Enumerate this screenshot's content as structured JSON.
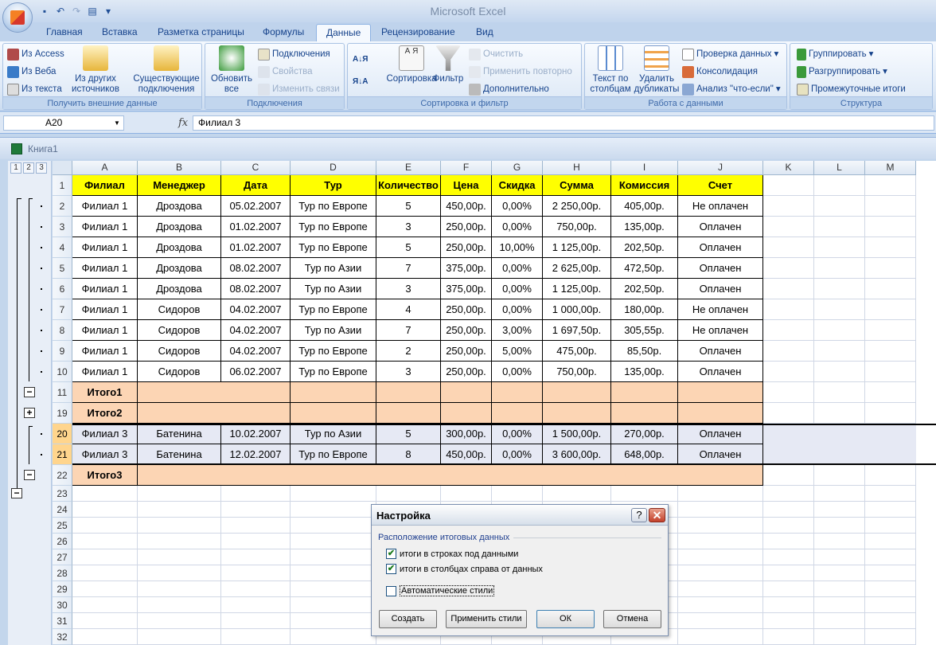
{
  "app": {
    "title": "Microsoft Excel",
    "workbook": "Книга1"
  },
  "tabs": [
    "Главная",
    "Вставка",
    "Разметка страницы",
    "Формулы",
    "Данные",
    "Рецензирование",
    "Вид"
  ],
  "active_tab": "Данные",
  "ribbon": {
    "external": {
      "caption": "Получить внешние данные",
      "from_access": "Из Access",
      "from_web": "Из Веба",
      "from_text": "Из текста",
      "from_other_1": "Из других",
      "from_other_2": "источников",
      "existing_1": "Существующие",
      "existing_2": "подключения"
    },
    "connections": {
      "caption": "Подключения",
      "refresh_1": "Обновить",
      "refresh_2": "все",
      "connections": "Подключения",
      "properties": "Свойства",
      "edit_links": "Изменить связи"
    },
    "sort": {
      "caption": "Сортировка и фильтр",
      "az": "А Я",
      "sort": "Сортировка",
      "filter": "Фильтр",
      "clear": "Очистить",
      "reapply": "Применить повторно",
      "advanced": "Дополнительно"
    },
    "datatools": {
      "caption": "Работа с данными",
      "text_cols_1": "Текст по",
      "text_cols_2": "столбцам",
      "remove_dup_1": "Удалить",
      "remove_dup_2": "дубликаты",
      "validation": "Проверка данных",
      "consolidate": "Консолидация",
      "whatif": "Анализ \"что-если\""
    },
    "outline": {
      "caption": "Структура",
      "group": "Группировать",
      "ungroup": "Разгруппировать",
      "subtotal": "Промежуточные итоги"
    }
  },
  "formula_bar": {
    "name_box": "A20",
    "fx": "fx",
    "value": "Филиал 3"
  },
  "outline_levels": [
    "1",
    "2",
    "3"
  ],
  "columns": [
    "A",
    "B",
    "C",
    "D",
    "E",
    "F",
    "G",
    "H",
    "I",
    "J",
    "K",
    "L",
    "M"
  ],
  "header_row": [
    "Филиал",
    "Менеджер",
    "Дата",
    "Тур",
    "Количество",
    "Цена",
    "Скидка",
    "Сумма",
    "Комиссия",
    "Счет"
  ],
  "rows": [
    {
      "n": "1",
      "type": "hdr"
    },
    {
      "n": "2",
      "type": "data",
      "cells": [
        "Филиал 1",
        "Дроздова",
        "05.02.2007",
        "Тур по Европе",
        "5",
        "450,00р.",
        "0,00%",
        "2 250,00р.",
        "405,00р.",
        "Не оплачен"
      ]
    },
    {
      "n": "3",
      "type": "data",
      "cells": [
        "Филиал 1",
        "Дроздова",
        "01.02.2007",
        "Тур по Европе",
        "3",
        "250,00р.",
        "0,00%",
        "750,00р.",
        "135,00р.",
        "Оплачен"
      ]
    },
    {
      "n": "4",
      "type": "data",
      "cells": [
        "Филиал 1",
        "Дроздова",
        "01.02.2007",
        "Тур по Европе",
        "5",
        "250,00р.",
        "10,00%",
        "1 125,00р.",
        "202,50р.",
        "Оплачен"
      ]
    },
    {
      "n": "5",
      "type": "data",
      "cells": [
        "Филиал 1",
        "Дроздова",
        "08.02.2007",
        "Тур по Азии",
        "7",
        "375,00р.",
        "0,00%",
        "2 625,00р.",
        "472,50р.",
        "Оплачен"
      ]
    },
    {
      "n": "6",
      "type": "data",
      "cells": [
        "Филиал 1",
        "Дроздова",
        "08.02.2007",
        "Тур по Азии",
        "3",
        "375,00р.",
        "0,00%",
        "1 125,00р.",
        "202,50р.",
        "Оплачен"
      ]
    },
    {
      "n": "7",
      "type": "data",
      "cells": [
        "Филиал 1",
        "Сидоров",
        "04.02.2007",
        "Тур по Европе",
        "4",
        "250,00р.",
        "0,00%",
        "1 000,00р.",
        "180,00р.",
        "Не оплачен"
      ]
    },
    {
      "n": "8",
      "type": "data",
      "cells": [
        "Филиал 1",
        "Сидоров",
        "04.02.2007",
        "Тур по Азии",
        "7",
        "250,00р.",
        "3,00%",
        "1 697,50р.",
        "305,55р.",
        "Не оплачен"
      ]
    },
    {
      "n": "9",
      "type": "data",
      "cells": [
        "Филиал 1",
        "Сидоров",
        "04.02.2007",
        "Тур по Европе",
        "2",
        "250,00р.",
        "5,00%",
        "475,00р.",
        "85,50р.",
        "Оплачен"
      ]
    },
    {
      "n": "10",
      "type": "data",
      "cells": [
        "Филиал 1",
        "Сидоров",
        "06.02.2007",
        "Тур по Европе",
        "3",
        "250,00р.",
        "0,00%",
        "750,00р.",
        "135,00р.",
        "Оплачен"
      ]
    },
    {
      "n": "11",
      "type": "total",
      "cells": [
        "Итого1"
      ]
    },
    {
      "n": "19",
      "type": "total",
      "cells": [
        "Итого2"
      ]
    },
    {
      "n": "20",
      "type": "sel",
      "cells": [
        "Филиал 3",
        "Батенина",
        "10.02.2007",
        "Тур по Азии",
        "5",
        "300,00р.",
        "0,00%",
        "1 500,00р.",
        "270,00р.",
        "Оплачен"
      ]
    },
    {
      "n": "21",
      "type": "sel",
      "cells": [
        "Филиал 3",
        "Батенина",
        "12.02.2007",
        "Тур по Европе",
        "8",
        "450,00р.",
        "0,00%",
        "3 600,00р.",
        "648,00р.",
        "Оплачен"
      ]
    },
    {
      "n": "22",
      "type": "total",
      "cells": [
        "Итого3"
      ]
    },
    {
      "n": "23",
      "type": "empty"
    },
    {
      "n": "24",
      "type": "empty"
    },
    {
      "n": "25",
      "type": "empty"
    },
    {
      "n": "26",
      "type": "empty"
    },
    {
      "n": "27",
      "type": "empty"
    },
    {
      "n": "28",
      "type": "empty"
    },
    {
      "n": "29",
      "type": "empty"
    },
    {
      "n": "30",
      "type": "empty"
    },
    {
      "n": "31",
      "type": "empty"
    },
    {
      "n": "32",
      "type": "empty"
    }
  ],
  "outline_buttons": {
    "minus": "−",
    "plus": "+"
  },
  "dialog": {
    "title": "Настройка",
    "help": "?",
    "close": "✕",
    "section": "Расположение итоговых данных",
    "check1": "итоги в строках под данными",
    "check2": "итоги в столбцах справа от данных",
    "check3": "Автоматические стили",
    "check1_state": true,
    "check2_state": true,
    "check3_state": false,
    "btn_create": "Создать",
    "btn_apply": "Применить стили",
    "btn_ok": "ОК",
    "btn_cancel": "Отмена"
  }
}
